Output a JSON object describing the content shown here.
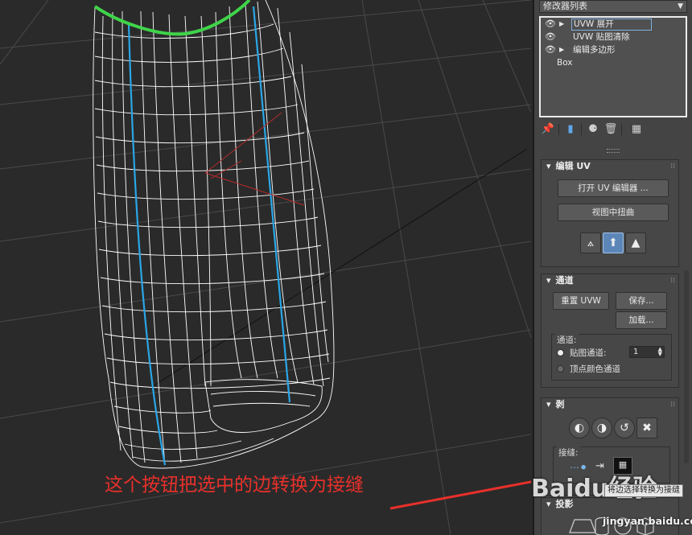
{
  "panel": {
    "modifier_list_label": "修改器列表",
    "stack": [
      {
        "label": "UVW 展开",
        "eye": true,
        "expand": true,
        "selected": true
      },
      {
        "label": "UVW 贴图清除",
        "eye": true,
        "expand": false,
        "selected": false
      },
      {
        "label": "编辑多边形",
        "eye": true,
        "expand": true,
        "selected": false
      },
      {
        "label": "Box",
        "eye": false,
        "expand": false,
        "selected": false
      }
    ]
  },
  "edit_uv": {
    "title": "编辑 UV",
    "open_editor": "打开 UV 编辑器 ...",
    "tweak_in_view": "视图中扭曲"
  },
  "channel": {
    "title": "通道",
    "reset_uvw": "重置 UVW",
    "save": "保存...",
    "load": "加载...",
    "group_title": "通道:",
    "map_channel_label": "贴图通道:",
    "map_channel_value": "1",
    "vertex_color_label": "顶点颜色通道"
  },
  "peel": {
    "title": "剥",
    "seams_title": "接缝:"
  },
  "projection": {
    "title": "投影"
  },
  "tooltip": "将边选择转换为接缝",
  "annotation": "这个按钮把选中的边转换为接缝",
  "watermark": {
    "logo": "Baidu经验",
    "site": "jingyan.baidu.com"
  },
  "colors": {
    "wire": "#ffffff",
    "seam_blue": "#2aa6e6",
    "selection_green": "#3fd44a",
    "annotation_red": "#e8302a",
    "panel_bg": "#444444"
  }
}
